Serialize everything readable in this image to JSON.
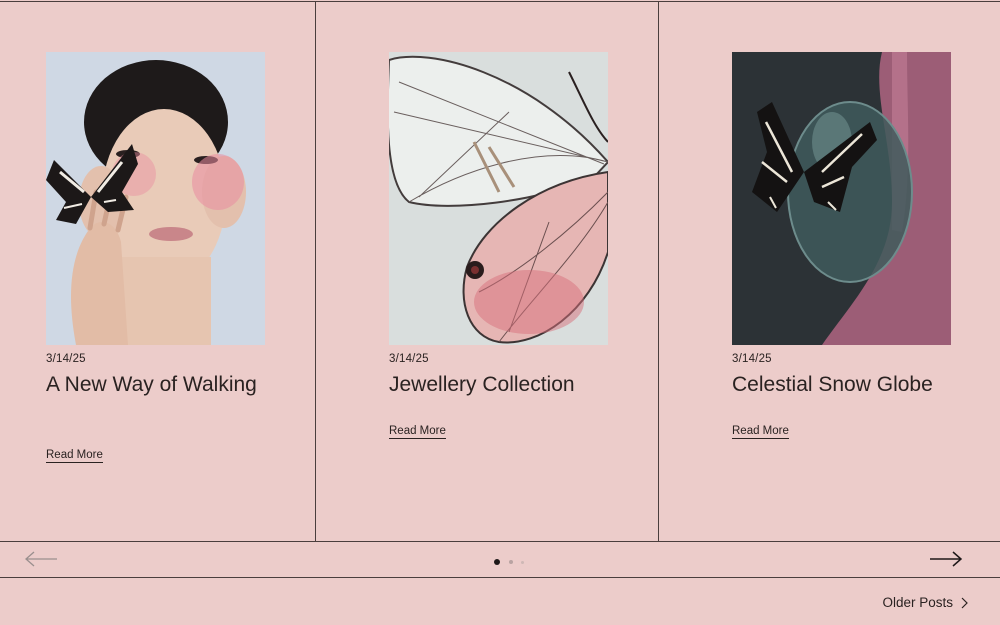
{
  "posts": [
    {
      "date": "3/14/25",
      "title": "A New Way of Walking",
      "read_more": "Read More",
      "image": "woman-with-butterfly"
    },
    {
      "date": "3/14/25",
      "title": "Jewellery Collection",
      "read_more": "Read More",
      "image": "butterfly-wing"
    },
    {
      "date": "3/14/25",
      "title": "Celestial Snow Globe",
      "read_more": "Read More",
      "image": "butterfly-on-glass-globe"
    }
  ],
  "pagination": {
    "dots": 3,
    "active_index": 0
  },
  "footer": {
    "older_posts_label": "Older Posts"
  },
  "colors": {
    "background": "#ecccca",
    "text": "#2a2221",
    "rule": "#4a3e3d"
  }
}
